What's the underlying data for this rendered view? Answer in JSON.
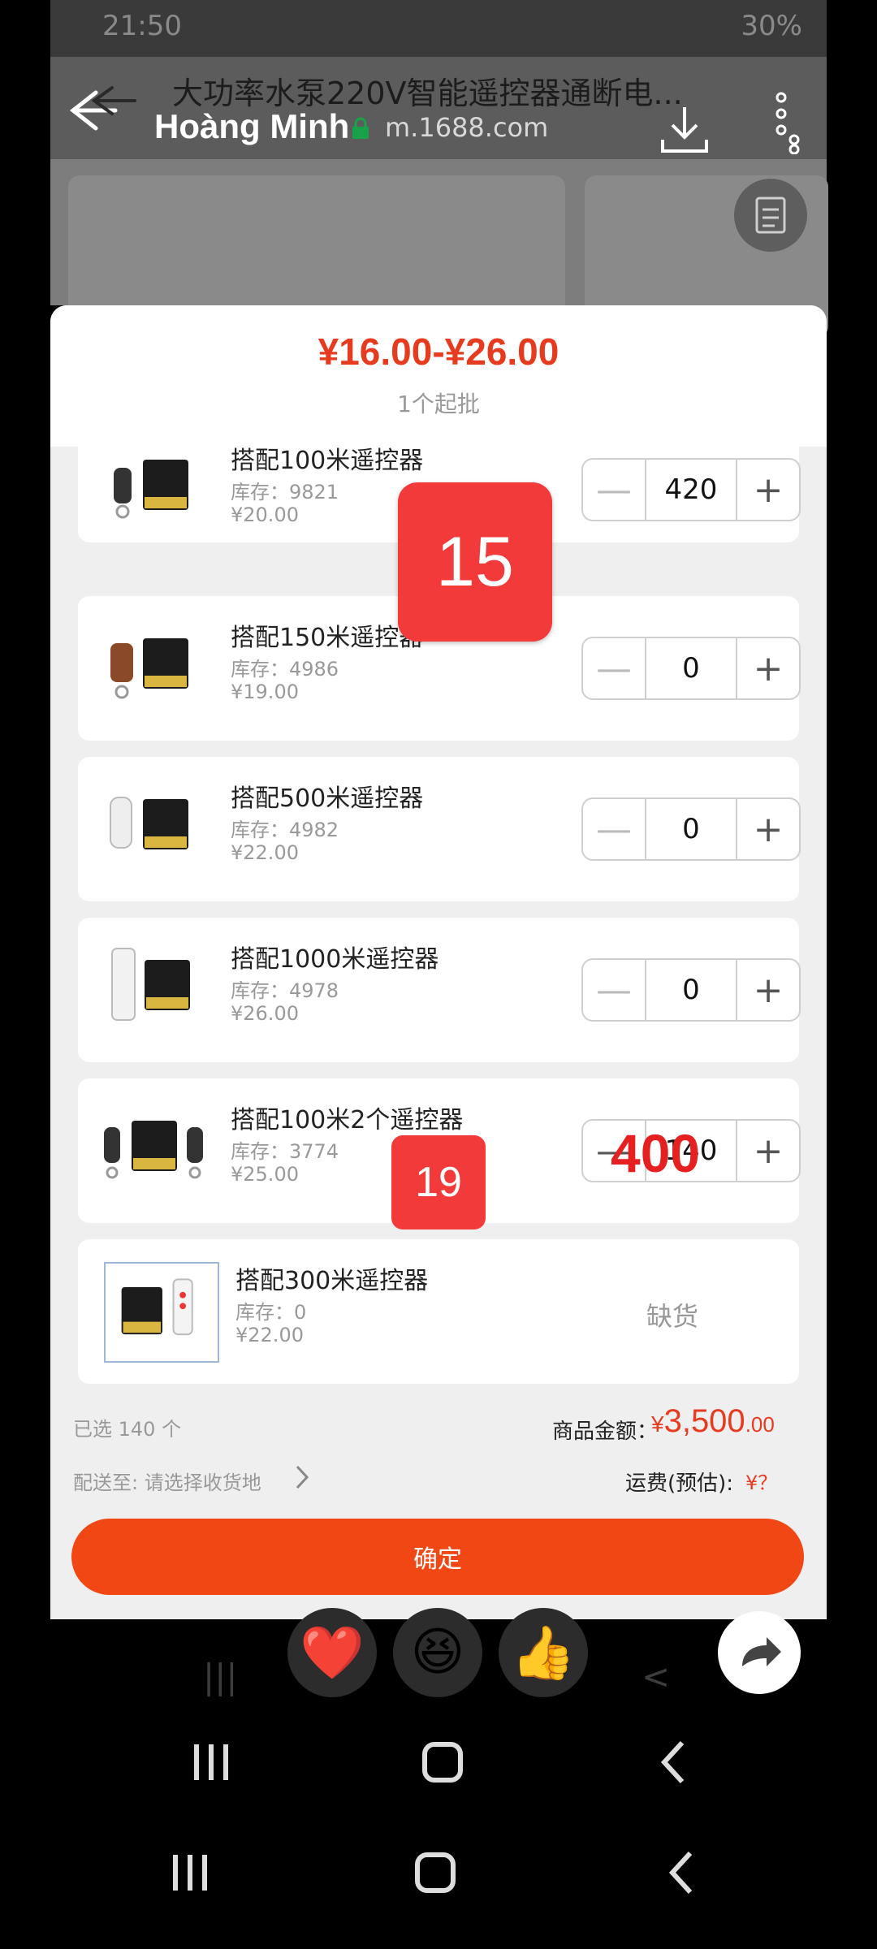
{
  "status_bar": {
    "time": "21:50",
    "battery": "30%"
  },
  "browser": {
    "title": "大功率水泵220V智能遥控器通断电...",
    "overlay_name": "Hoàng Minh",
    "url": "m.1688.com"
  },
  "sheet": {
    "price_range": "¥16.00-¥26.00",
    "moq": "1个起批",
    "rows": [
      {
        "name": "搭配100米遥控器",
        "stock": "库存：9821",
        "price": "¥20.00",
        "qty": "420"
      },
      {
        "name": "搭配150米遥控器",
        "stock": "库存：4986",
        "price": "¥19.00",
        "qty": "0"
      },
      {
        "name": "搭配500米遥控器",
        "stock": "库存：4982",
        "price": "¥22.00",
        "qty": "0"
      },
      {
        "name": "搭配1000米遥控器",
        "stock": "库存：4978",
        "price": "¥26.00",
        "qty": "0"
      },
      {
        "name": "搭配100米2个遥控器",
        "stock": "库存：3774",
        "price": "¥25.00",
        "qty": "140"
      },
      {
        "name": "搭配300米遥控器",
        "stock": "库存：0",
        "price": "¥22.00",
        "status": "缺货"
      }
    ],
    "overlays": {
      "badge_a": "15",
      "badge_b": "19",
      "red_text": "400"
    }
  },
  "summary": {
    "selected": "已选 140 个",
    "amount_label": "商品金额：",
    "amount_currency": "¥",
    "amount_main": "3,500",
    "amount_decimal": ".00",
    "ship_to": "配送至:   请选择收货地",
    "freight_label": "运费(预估):",
    "freight_value": "¥？",
    "confirm": "确定"
  },
  "reactions": [
    {
      "name": "heart",
      "glyph": "❤️"
    },
    {
      "name": "laugh",
      "glyph": "😆"
    },
    {
      "name": "thumbs-up",
      "glyph": "👍"
    }
  ],
  "colors": {
    "accent": "#f04714",
    "price": "#e63b1f",
    "badge": "#f33a3a"
  }
}
